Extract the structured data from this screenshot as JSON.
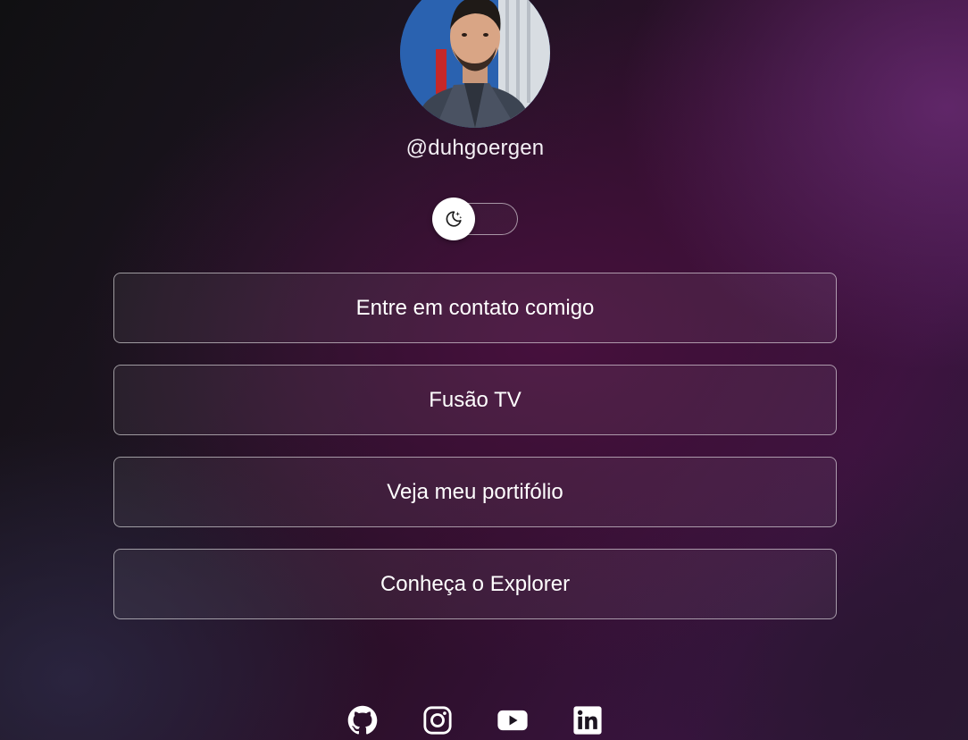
{
  "profile": {
    "handle": "@duhgoergen",
    "avatar_icon": "profile-photo"
  },
  "theme_toggle": {
    "icon": "moon-stars-icon",
    "state": "dark"
  },
  "links": [
    {
      "label": "Entre em contato comigo"
    },
    {
      "label": "Fusão TV"
    },
    {
      "label": "Veja meu portifólio"
    },
    {
      "label": "Conheça o Explorer"
    }
  ],
  "socials": [
    {
      "icon": "github-icon"
    },
    {
      "icon": "instagram-icon"
    },
    {
      "icon": "youtube-icon"
    },
    {
      "icon": "linkedin-icon"
    }
  ],
  "colors": {
    "text": "#ffffff",
    "button_border": "#bdb3c2",
    "accent_purple": "#5a2468",
    "background_dark": "#101012"
  }
}
